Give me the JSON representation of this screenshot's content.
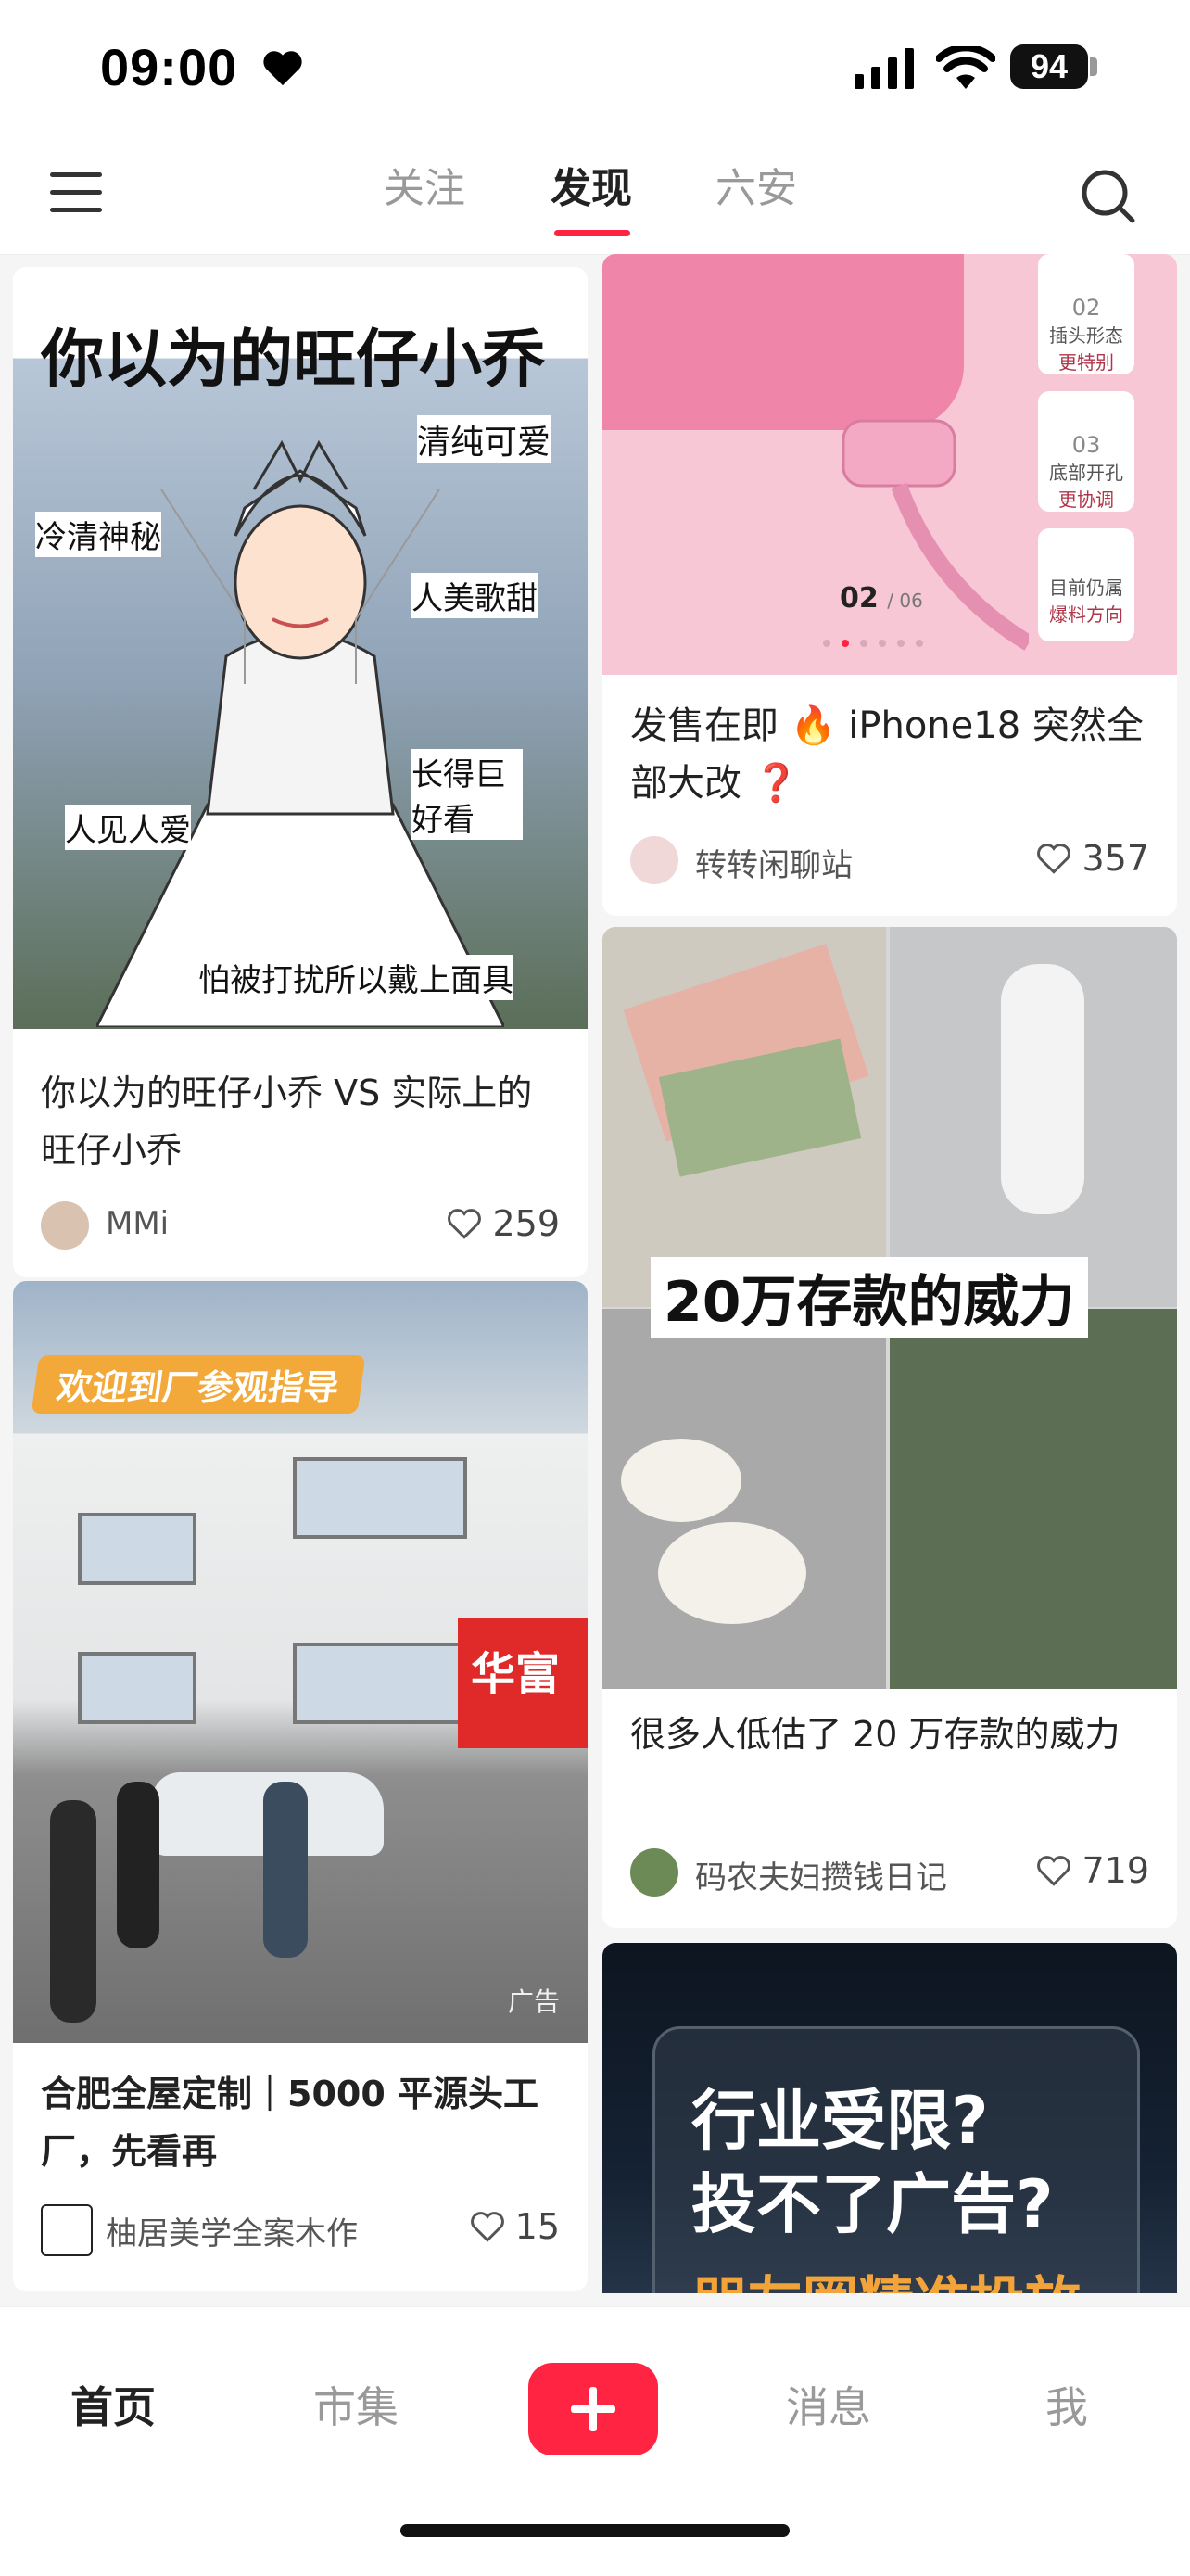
{
  "status": {
    "time": "09:00",
    "battery": "94"
  },
  "header": {
    "tabs": [
      {
        "label": "关注",
        "active": false
      },
      {
        "label": "发现",
        "active": true
      },
      {
        "label": "六安",
        "active": false
      }
    ],
    "accent": "#ff2442"
  },
  "feed": {
    "cards": [
      {
        "image_title": "你以为的旺仔小乔",
        "image_captions": [
          "清纯可爱",
          "冷清神秘",
          "人美歌甜",
          "长得巨好看",
          "人见人爱",
          "怕被打扰所以戴上面具"
        ],
        "title": "你以为的旺仔小乔 VS 实际上的旺仔小乔",
        "author": "MMi",
        "likes": "259"
      },
      {
        "image_counter_current": "02",
        "image_counter_total": "/ 06",
        "image_side_labels": [
          {
            "num": "02",
            "line1": "插头形态",
            "line2": "更特别"
          },
          {
            "num": "03",
            "line1": "底部开孔",
            "line2": "更协调"
          },
          {
            "num": "",
            "line1": "目前仍属",
            "line2": "爆料方向"
          }
        ],
        "title": "发售在即 🔥 iPhone18 突然全部大改 ❓",
        "author": "转转闲聊站",
        "likes": "357"
      },
      {
        "image_title": "欢迎到厂参观指导",
        "image_sign": "华富",
        "ad_label": "广告",
        "title": "合肥全屋定制｜5000 平源头工厂，先看再",
        "author": "柚居美学全案木作",
        "likes": "15"
      },
      {
        "image_title": "20万存款的威力",
        "title": "很多人低估了 20 万存款的威力",
        "author": "码农夫妇攒钱日记",
        "likes": "719"
      },
      {
        "image_title_line1": "行业受限?",
        "image_title_line2": "投不了广告?",
        "image_title_line3": "朋友圈精准投放"
      }
    ]
  },
  "bottom_nav": {
    "items": [
      {
        "label": "首页",
        "active": true
      },
      {
        "label": "市集",
        "active": false
      },
      {
        "label": "消息",
        "active": false
      },
      {
        "label": "我",
        "active": false
      }
    ]
  }
}
